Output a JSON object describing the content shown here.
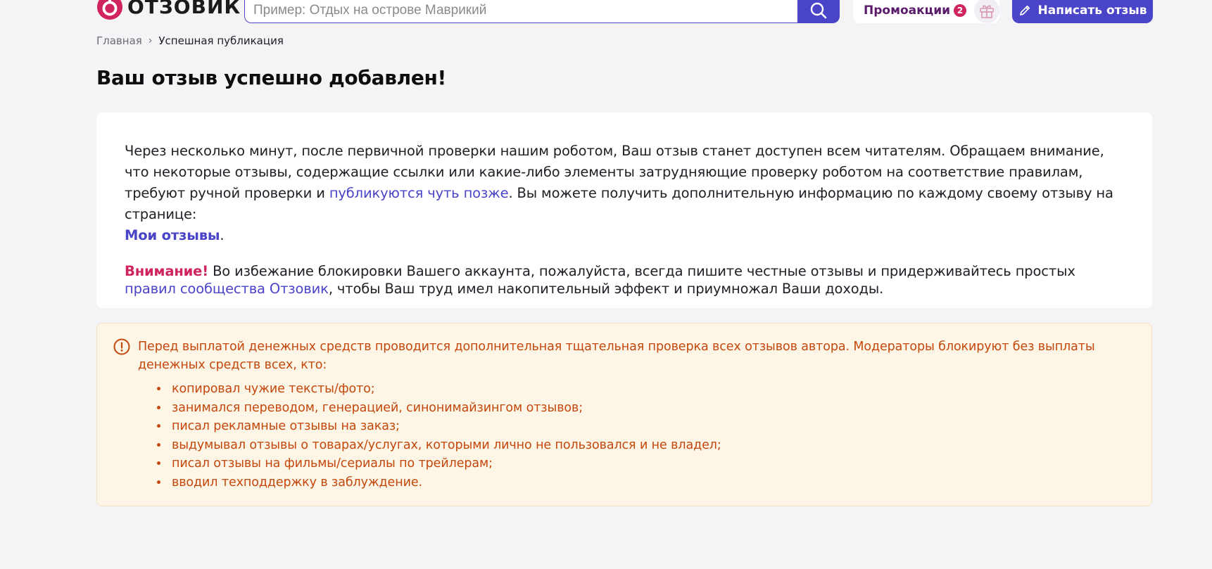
{
  "header": {
    "logo_text": "ОТЗОВИК",
    "search_placeholder": "Пример: Отдых на острове Маврикий",
    "promo_label": "Промоакции",
    "promo_count": "2",
    "write_review_label": "Написать отзыв"
  },
  "breadcrumb": {
    "home": "Главная",
    "separator": "›",
    "current": "Успешная публикация"
  },
  "title": "Ваш отзыв успешно добавлен!",
  "card": {
    "p1_before": "Через несколько минут, после первичной проверки нашим роботом, Ваш отзыв станет доступен всем читателям. Обращаем внимание, что некоторые отзывы, содержащие ссылки или какие-либо элементы затрудняющие проверку роботом на соответствие правилам, требуют ручной проверки и ",
    "p1_link": "публикуются чуть позже",
    "p1_middle": ". Вы можете получить дополнительную информацию по каждому своему отзыву на странице: ",
    "p1_my_reviews": "Мои отзывы",
    "p1_end": ".",
    "attention": "Внимание!",
    "p2_text": " Во избежание блокировки Вашего аккаунта, пожалуйста, всегда пишите честные отзывы и придерживайтесь простых ",
    "p2_link": "правил сообщества Отзовик",
    "p2_end": ", чтобы Ваш труд имел накопительный эффект и приумножал Ваши доходы."
  },
  "notice": {
    "intro": "Перед выплатой денежных средств проводится дополнительная тщательная проверка всех отзывов автора. Модераторы блокируют без выплаты денежных средств всех, кто:",
    "items": [
      "копировал чужие тексты/фото;",
      "занимался переводом, генерацией, синонимайзингом отзывов;",
      "писал рекламные отзывы на заказ;",
      "выдумывал отзывы о товарах/услугах, которыми лично не пользовался и не владел;",
      "писал отзывы на фильмы/сериалы по трейлерам;",
      "вводил техподдержку в заблуждение."
    ]
  },
  "colors": {
    "accent": "#4a44c8",
    "brand_red": "#d0245f",
    "notice_text": "#c4480e",
    "notice_bg": "#fdf5e5",
    "page_bg": "#f4f4f6"
  },
  "icons": {
    "logo": "otzovik-logo-icon",
    "search": "search-icon",
    "gift": "gift-icon",
    "write": "pencil-icon",
    "notice": "exclamation-circle-icon"
  }
}
